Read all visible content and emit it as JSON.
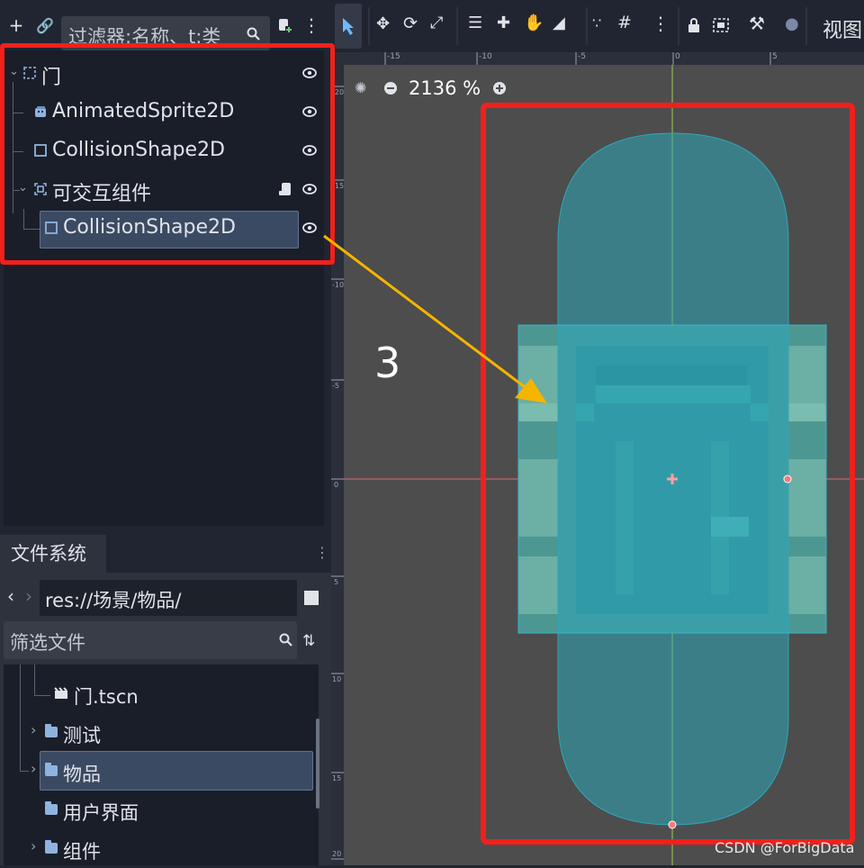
{
  "scene_dock": {
    "filter_placeholder": "过滤器:名称、t:类",
    "tree": [
      {
        "label": "门",
        "icon": "node2d-icon",
        "level": 0
      },
      {
        "label": "AnimatedSprite2D",
        "icon": "animated-sprite-icon",
        "level": 1
      },
      {
        "label": "CollisionShape2D",
        "icon": "collision-shape-icon",
        "level": 1
      },
      {
        "label": "可交互组件",
        "icon": "area2d-icon",
        "level": 1
      },
      {
        "label": "CollisionShape2D",
        "icon": "collision-shape-icon",
        "level": 2,
        "selected": true
      }
    ]
  },
  "filesystem": {
    "tab_label": "文件系统",
    "path": "res://场景/物品/",
    "filter_placeholder": "筛选文件",
    "items": [
      {
        "label": "门.tscn",
        "type": "scene"
      },
      {
        "label": "测试",
        "type": "folder"
      },
      {
        "label": "物品",
        "type": "folder",
        "selected": true
      },
      {
        "label": "用户界面",
        "type": "folder"
      },
      {
        "label": "组件",
        "type": "folder"
      }
    ]
  },
  "viewport": {
    "view_menu": "视图",
    "zoom": "2136 %",
    "ruler_top": [
      "-15",
      "-10",
      "-5",
      "0",
      "5"
    ],
    "ruler_left": [
      "-20",
      "-15",
      "-10",
      "-5",
      "0",
      "5",
      "10",
      "15",
      "20"
    ],
    "annotation": "3",
    "watermark": "CSDN @ForBigData"
  },
  "colors": {
    "accent": "#f2201b",
    "arrow": "#f5b400",
    "shape_fill": "#2ea7b8",
    "bg": "#202531"
  }
}
